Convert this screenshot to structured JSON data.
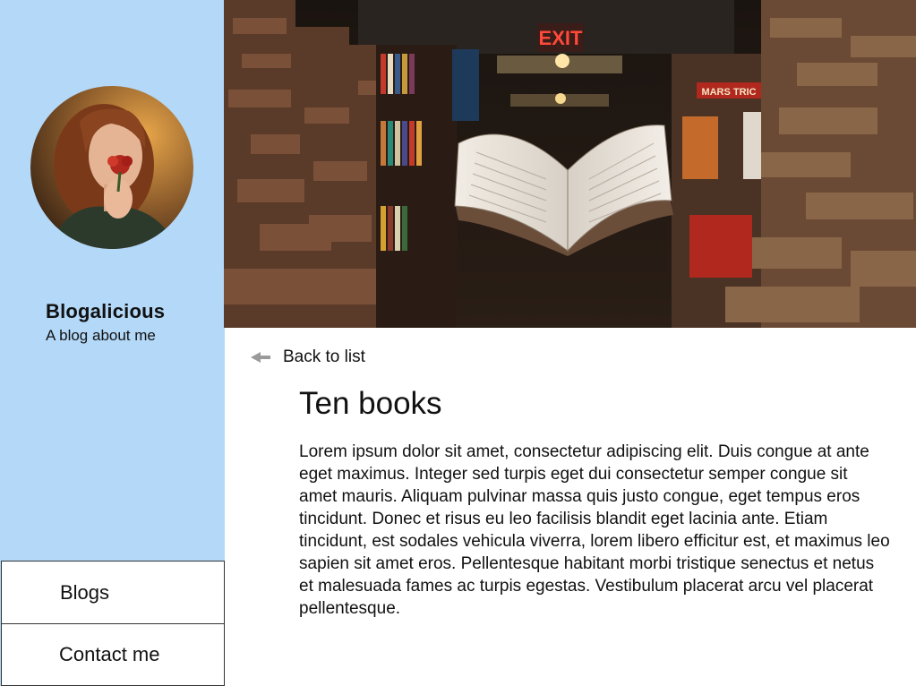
{
  "sidebar": {
    "avatar_icon": "person-photo",
    "title": "Blogalicious",
    "tagline": "A blog about me",
    "nav": [
      {
        "label": "Blogs"
      },
      {
        "label": "Contact me"
      }
    ],
    "background_color": "#b3d8f8"
  },
  "hero": {
    "image_subject": "library with floating open book",
    "exit_sign": "EXIT",
    "shelf_label": "MARS TRIC"
  },
  "post": {
    "back_label": "Back to list",
    "back_icon": "left-arrow-icon",
    "title": "Ten books",
    "body": "Lorem ipsum dolor sit amet, consectetur adipiscing elit. Duis congue at ante eget maximus. Integer sed turpis eget dui consectetur semper congue sit amet mauris. Aliquam pulvinar massa quis justo congue, eget tempus eros tincidunt. Donec et risus eu leo facilisis blandit eget lacinia ante. Etiam tincidunt, est sodales vehicula viverra, lorem libero efficitur est, et maximus leo sapien sit amet eros. Pellentesque habitant morbi tristique senectus et netus et malesuada fames ac turpis egestas. Vestibulum placerat arcu vel placerat pellentesque."
  }
}
